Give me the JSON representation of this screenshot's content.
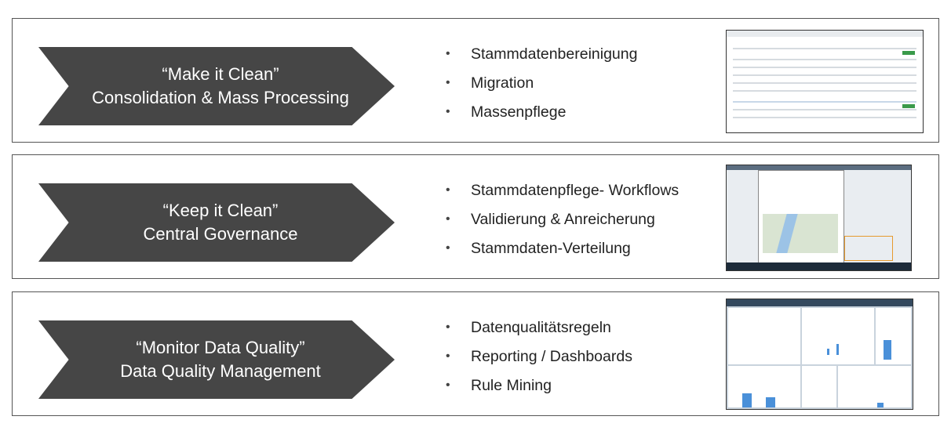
{
  "rows": [
    {
      "title": "“Make it Clean”",
      "subtitle": "Consolidation & Mass Processing",
      "bullets": [
        "Stammdatenbereinigung",
        "Migration",
        "Massenpflege"
      ],
      "thumbnail": "mass-processing-table-screenshot"
    },
    {
      "title": "“Keep it Clean”",
      "subtitle": "Central Governance",
      "bullets": [
        "Stammdatenpflege- Workflows",
        "Validierung & Anreicherung",
        "Stammdaten-Verteilung"
      ],
      "thumbnail": "change-request-map-dialog-screenshot"
    },
    {
      "title": "“Monitor Data Quality”",
      "subtitle": "Data Quality Management",
      "bullets": [
        "Datenqualitätsregeln",
        "Reporting / Dashboards",
        "Rule Mining"
      ],
      "thumbnail": "data-quality-dashboard-screenshot"
    }
  ],
  "colors": {
    "chevron": "#464646",
    "border": "#555555",
    "accent": "#4a90d9"
  }
}
